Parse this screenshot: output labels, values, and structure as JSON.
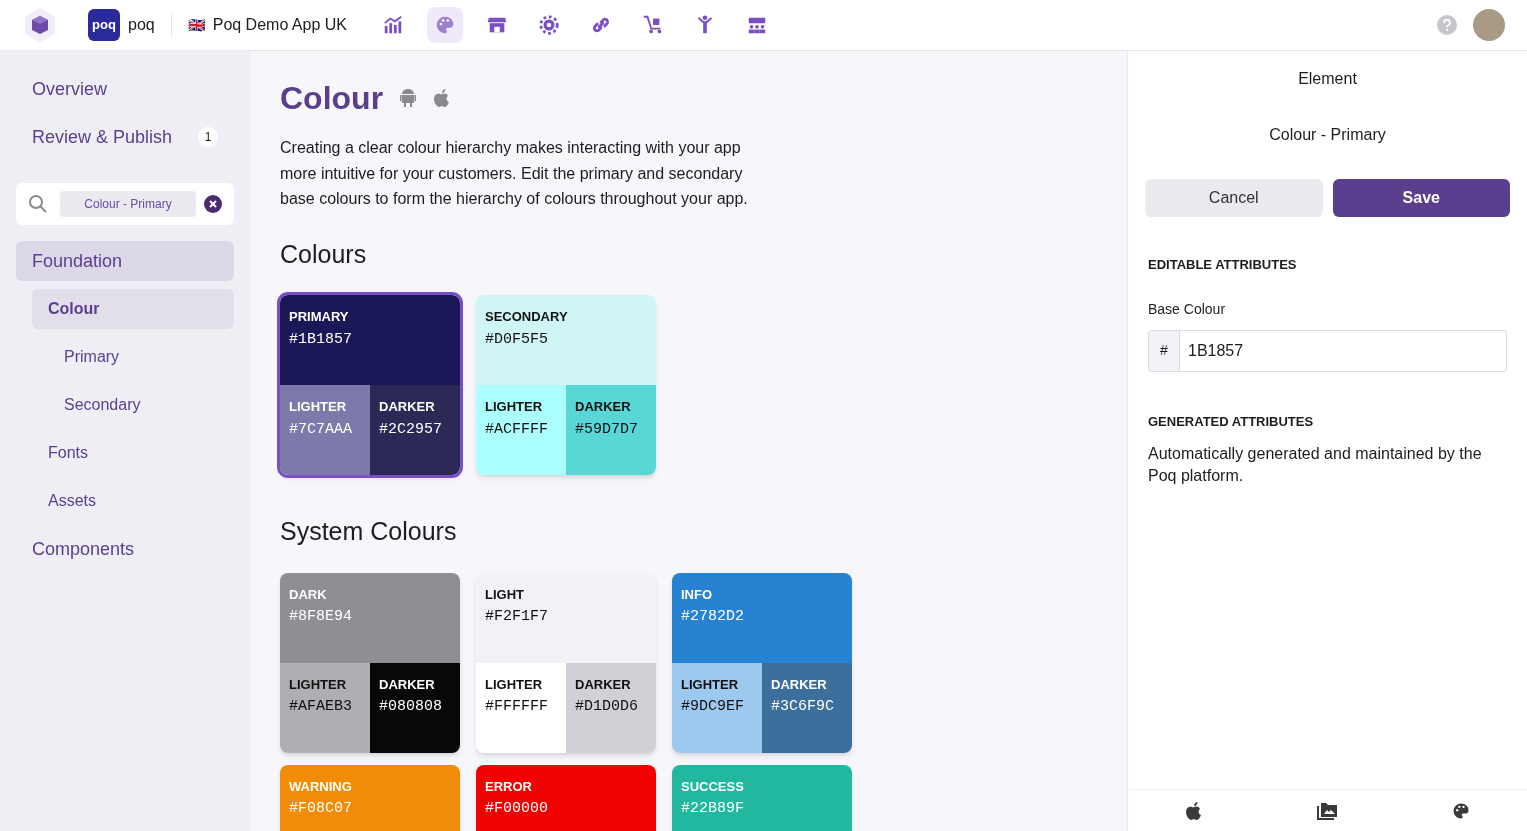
{
  "topbar": {
    "logo_text": "poq",
    "brand_text": "poq",
    "app_name": "Poq Demo App UK",
    "flag": "🇬🇧",
    "nav": [
      {
        "selected": false
      },
      {
        "selected": true
      },
      {
        "selected": false
      },
      {
        "selected": false
      },
      {
        "selected": false
      },
      {
        "selected": false
      },
      {
        "selected": false
      },
      {
        "selected": false
      }
    ]
  },
  "sidebar": {
    "items": [
      {
        "label": "Overview",
        "selected": false
      },
      {
        "label": "Review & Publish",
        "badge": "1",
        "selected": false
      }
    ],
    "search": {
      "value": "Colour - Primary"
    },
    "tree": [
      {
        "label": "Foundation",
        "selected": false,
        "expanded": true,
        "children": [
          {
            "label": "Colour",
            "selected": true,
            "expanded": true,
            "children": [
              {
                "label": "Primary",
                "selected": false
              },
              {
                "label": "Secondary",
                "selected": false
              }
            ]
          },
          {
            "label": "Fonts",
            "selected": false
          },
          {
            "label": "Assets",
            "selected": false
          }
        ]
      },
      {
        "label": "Components",
        "selected": false
      }
    ]
  },
  "main": {
    "title": "Colour",
    "description": "Creating a clear colour hierarchy makes interacting with your app more intuitive for your customers. Edit the primary and secondary base colours to form the hierarchy of colours throughout your app.",
    "sections": [
      {
        "title": "Colours",
        "swatches": [
          {
            "label": "PRIMARY",
            "hex": "#1B1857",
            "color": "#1b1857",
            "selected": true,
            "lighter": {
              "label": "LIGHTER",
              "hex": "#7C7AAA",
              "color": "#7c7aaa"
            },
            "darker": {
              "label": "DARKER",
              "hex": "#2C2957",
              "color": "#2c2957"
            }
          },
          {
            "label": "SECONDARY",
            "hex": "#D0F5F5",
            "color": "#d0f5f5",
            "selected": false,
            "lighter": {
              "label": "LIGHTER",
              "hex": "#ACFFFF",
              "color": "#acffff"
            },
            "darker": {
              "label": "DARKER",
              "hex": "#59D7D7",
              "color": "#59d7d7"
            }
          }
        ]
      },
      {
        "title": "System Colours",
        "swatches": [
          {
            "label": "DARK",
            "hex": "#8F8E94",
            "color": "#8f8e94",
            "selected": false,
            "lighter": {
              "label": "LIGHTER",
              "hex": "#AFAEB3",
              "color": "#afaeb3"
            },
            "darker": {
              "label": "DARKER",
              "hex": "#080808",
              "color": "#080808"
            }
          },
          {
            "label": "LIGHT",
            "hex": "#F2F1F7",
            "color": "#f2f1f7",
            "selected": false,
            "lighter": {
              "label": "LIGHTER",
              "hex": "#FFFFFF",
              "color": "#ffffff"
            },
            "darker": {
              "label": "DARKER",
              "hex": "#D1D0D6",
              "color": "#d1d0d6"
            }
          },
          {
            "label": "INFO",
            "hex": "#2782D2",
            "color": "#2782d2",
            "selected": false,
            "lighter": {
              "label": "LIGHTER",
              "hex": "#9DC9EF",
              "color": "#9dc9ef"
            },
            "darker": {
              "label": "DARKER",
              "hex": "#3C6F9C",
              "color": "#3c6f9c"
            }
          },
          {
            "label": "WARNING",
            "hex": "#F08C07",
            "color": "#f08c07",
            "selected": false
          },
          {
            "label": "ERROR",
            "hex": "#F00000",
            "color": "#f00000",
            "selected": false
          },
          {
            "label": "SUCCESS",
            "hex": "#22B89F",
            "color": "#22b89f",
            "selected": false
          }
        ]
      }
    ]
  },
  "panel": {
    "heading": "Element",
    "element_name": "Colour - Primary",
    "cancel": "Cancel",
    "save": "Save",
    "editable_title": "EDITABLE ATTRIBUTES",
    "field_label": "Base Colour",
    "field_prefix": "#",
    "field_value": "1B1857",
    "generated_title": "GENERATED ATTRIBUTES",
    "generated_text": "Automatically generated and maintained by the Poq platform."
  }
}
